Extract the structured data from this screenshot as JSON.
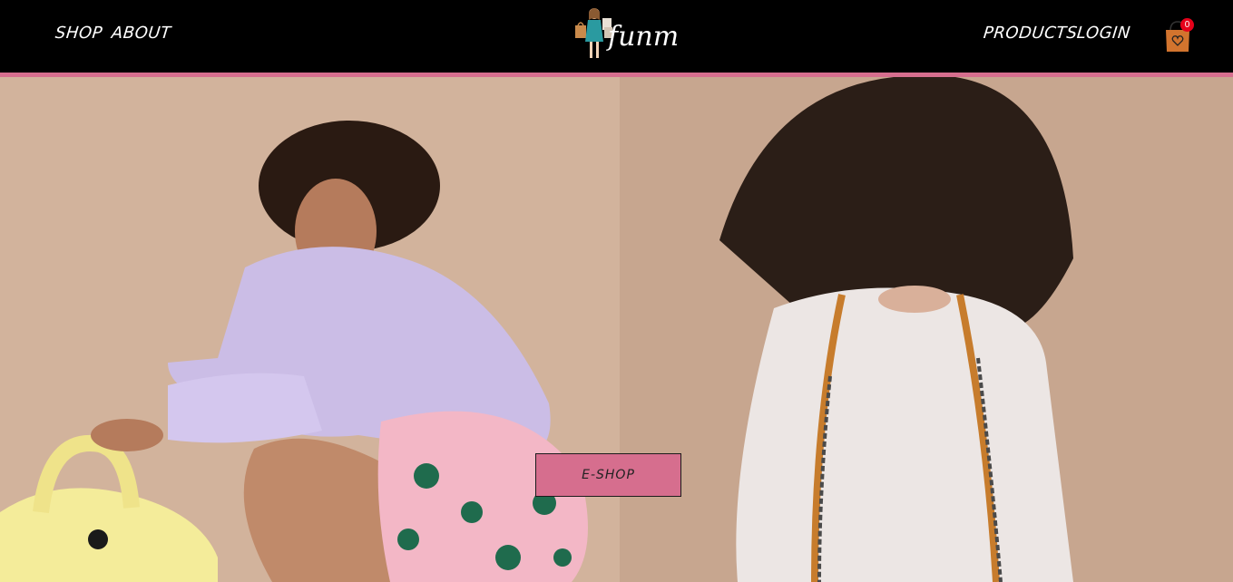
{
  "nav": {
    "shop": "SHOP",
    "about": "ABOUT",
    "products": "PRODUCTS",
    "login": "LOGIN"
  },
  "logo": {
    "text": "funmi"
  },
  "cart": {
    "count": "0",
    "icon": "shopping-bag-icon"
  },
  "hero": {
    "button_label": "E-SHOP"
  },
  "colors": {
    "header_bg": "#000000",
    "accent_pink": "#d66e8e",
    "badge_red": "#e5001a",
    "left_panel_bg": "#d2b39c",
    "right_panel_bg": "#c7a68f"
  }
}
